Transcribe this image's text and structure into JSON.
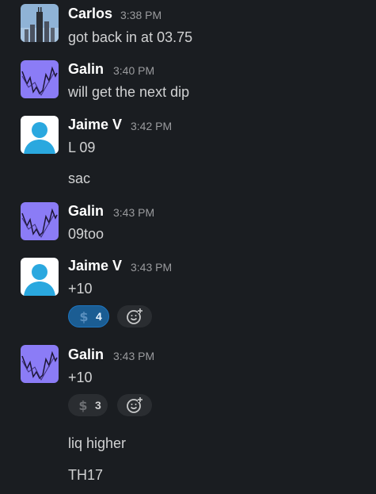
{
  "messages": [
    {
      "user": "Carlos",
      "time": "3:38 PM",
      "lines": [
        "got back in at 03.75"
      ]
    },
    {
      "user": "Galin",
      "time": "3:40 PM",
      "lines": [
        "will get the next dip"
      ]
    },
    {
      "user": "Jaime V",
      "time": "3:42 PM",
      "lines": [
        "L 09",
        "sac"
      ]
    },
    {
      "user": "Galin",
      "time": "3:43 PM",
      "lines": [
        "09too"
      ]
    },
    {
      "user": "Jaime V",
      "time": "3:43 PM",
      "lines": [
        "+10"
      ],
      "reaction": {
        "icon": "dollar-icon",
        "count": "4",
        "active": true
      }
    },
    {
      "user": "Galin",
      "time": "3:43 PM",
      "lines": [
        "+10",
        "liq higher",
        "TH17"
      ],
      "reaction": {
        "icon": "dollar-icon",
        "count": "3",
        "active": false
      }
    }
  ],
  "colors": {
    "background": "#1a1d21",
    "accent": "#1d75c0",
    "galin_avatar": "#8b7cf6",
    "jaime_avatar": "#2aa8df"
  }
}
